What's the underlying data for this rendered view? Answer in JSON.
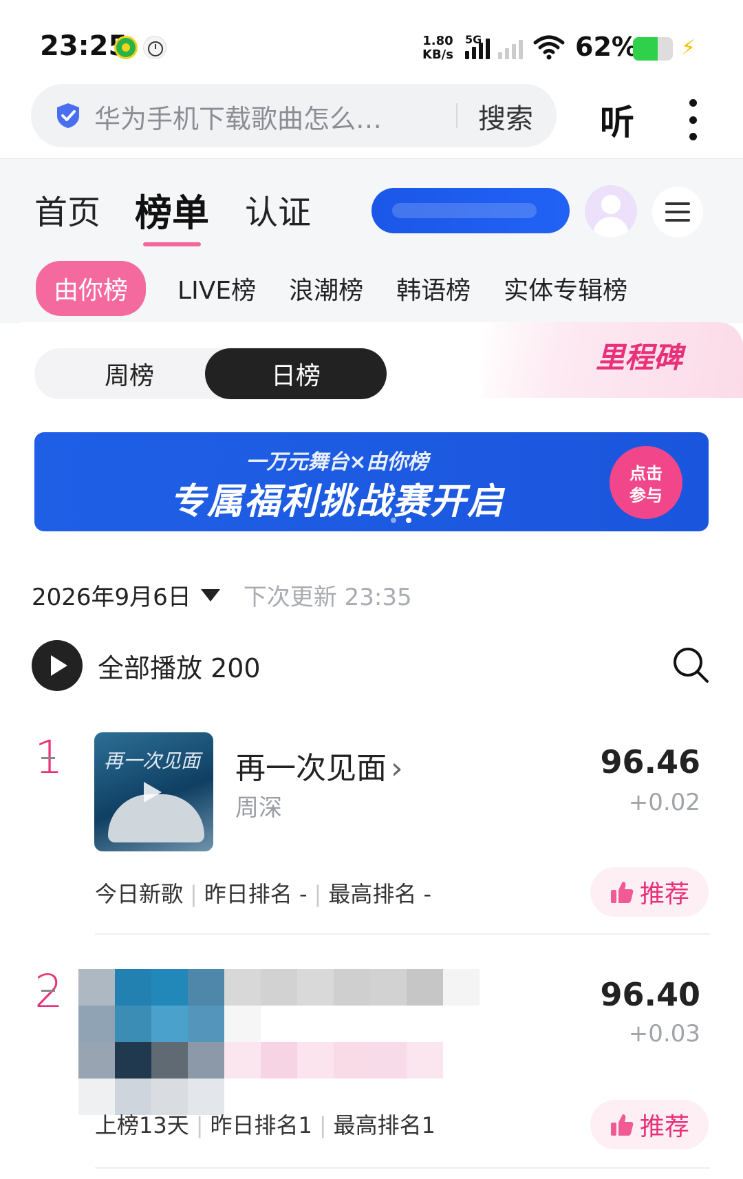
{
  "status_bar": {
    "time": "23:25",
    "net_speed_value": "1.80",
    "net_speed_unit": "KB/s",
    "network": "5G",
    "battery_percent": "62%",
    "battery_level": 0.62,
    "icons": [
      "app-notification-icon",
      "timer-icon",
      "signal-icon",
      "wifi-icon",
      "battery-icon",
      "charging-icon"
    ]
  },
  "search": {
    "query": "华为手机下载歌曲怎么…",
    "button": "搜索",
    "listen": "听"
  },
  "nav": {
    "tabs": [
      "首页",
      "榜单",
      "认证"
    ],
    "active_tab": "榜单"
  },
  "subtabs": [
    "由你榜",
    "LIVE榜",
    "浪潮榜",
    "韩语榜",
    "实体专辑榜"
  ],
  "milestone_label": "里程碑",
  "period_toggle": {
    "weekly": "周榜",
    "daily": "日榜",
    "selected": "日榜"
  },
  "banner": {
    "subtitle": "一万元舞台×由你榜",
    "title": "专属福利挑战赛开启",
    "cta_line1": "点击",
    "cta_line2": "参与"
  },
  "chart_header": {
    "date": "2026年9月6日",
    "next_update": "下次更新 23:35",
    "play_all": "全部播放 200"
  },
  "songs": [
    {
      "rank": "1",
      "cover_text": "再一次见面",
      "title": "再一次见面",
      "title_arrow": "›",
      "artist": "周深",
      "score": "96.46",
      "delta": "+0.02",
      "meta_1": "今日新歌",
      "meta_2": "昨日排名 -",
      "meta_3": "最高排名 -",
      "recommend": "推荐"
    },
    {
      "rank": "2",
      "score": "96.40",
      "delta": "+0.03",
      "meta_1": "上榜13天",
      "meta_2": "昨日排名1",
      "meta_3": "最高排名1",
      "recommend": "推荐"
    }
  ],
  "colors": {
    "accent_pink": "#e8317a",
    "pill_pink": "#f46a9f",
    "banner_blue": "#1f5fe6"
  }
}
